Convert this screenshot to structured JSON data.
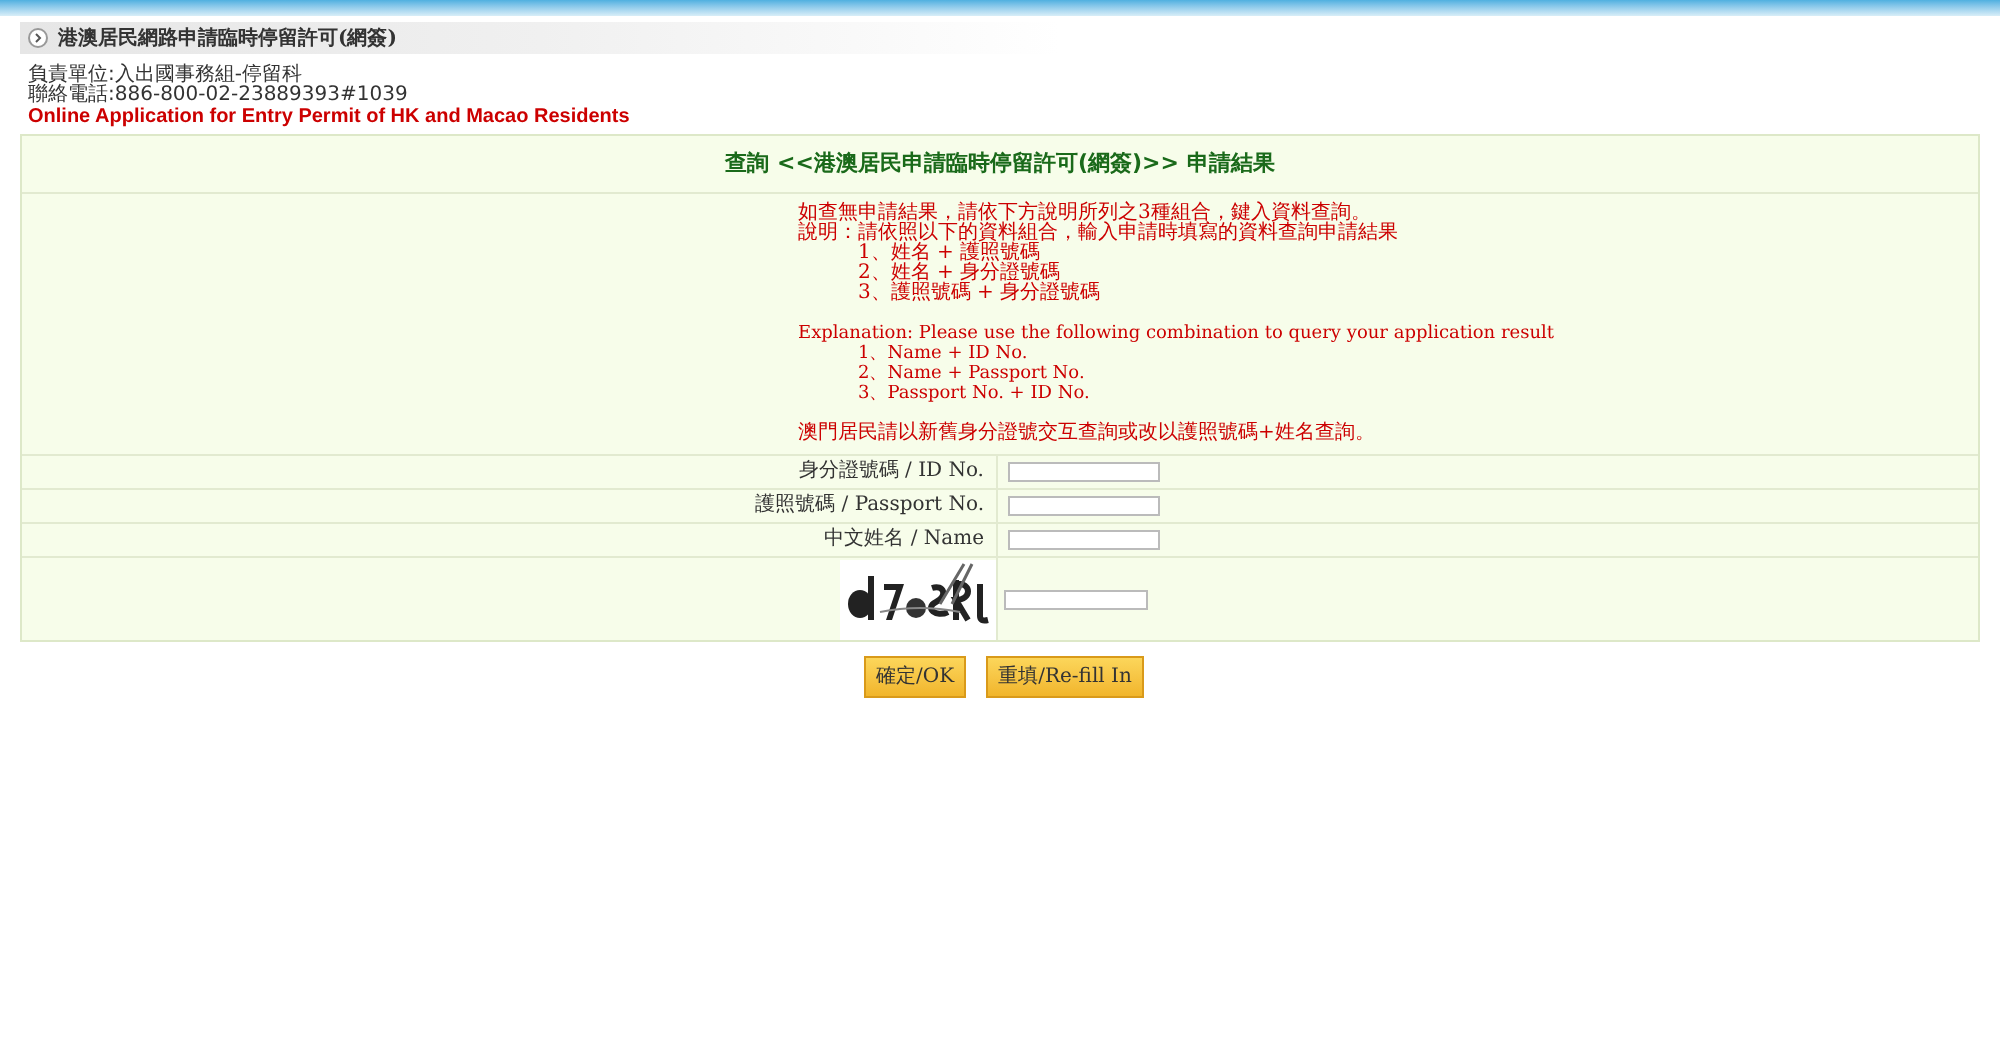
{
  "header": {
    "title": "港澳居民網路申請臨時停留許可(網簽)",
    "info_lines": [
      "負責單位:入出國事務組-停留科",
      "聯絡電話:886-800-02-23889393#1039"
    ],
    "subtitle": "Online Application for Entry Permit of HK and Macao Residents"
  },
  "panel": {
    "title": "查詢 <<港澳居民申請臨時停留許可(網簽)>> 申請結果",
    "intro": [
      "如查無申請結果，請依下方說明所列之3種組合，鍵入資料查詢。",
      "說明：請依照以下的資料組合，輸入申請時填寫的資料查詢申請結果"
    ],
    "combos_zh": [
      "1、姓名 + 護照號碼",
      "2、姓名 + 身分證號碼",
      "3、護照號碼 + 身分證號碼"
    ],
    "explanation": "Explanation: Please use the following combination to query your application result",
    "combos_en": [
      "1、Name + ID No.",
      "2、Name + Passport No.",
      "3、Passport No. + ID No."
    ],
    "note": "澳門居民請以新舊身分證號交互查詢或改以護照號碼+姓名查詢。",
    "fields": [
      {
        "label": "身分證號碼 / ID No."
      },
      {
        "label": "護照號碼 / Passport No."
      },
      {
        "label": "中文姓名 / Name"
      }
    ],
    "captcha": {
      "kind": "picture"
    }
  },
  "buttons": [
    "確定/OK",
    "重填/Re-fill In"
  ]
}
